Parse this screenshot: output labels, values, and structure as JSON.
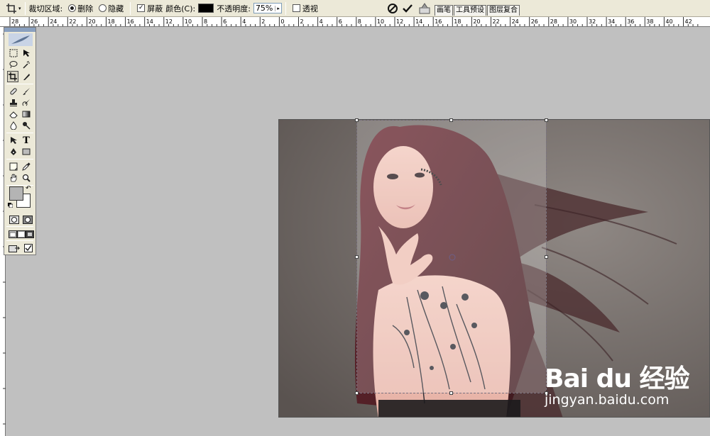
{
  "options_bar": {
    "crop_area_label": "裁切区域:",
    "delete_label": "删除",
    "hide_label": "隐藏",
    "shield_label": "屏蔽",
    "color_label": "颜色(C):",
    "shield_color": "#000000",
    "opacity_label": "不透明度:",
    "opacity_value": "75%",
    "perspective_label": "透视",
    "selected_mode": "删除",
    "shield_checked": true,
    "perspective_checked": false
  },
  "palette_tabs": [
    "画笔",
    "工具预设",
    "图层复合"
  ],
  "ruler_top_labels": [
    "28",
    "26",
    "24",
    "22",
    "20",
    "18",
    "16",
    "14",
    "12",
    "10",
    "8",
    "6",
    "4",
    "2",
    "0",
    "2",
    "4",
    "6",
    "8",
    "10",
    "12",
    "14",
    "16",
    "18",
    "20",
    "22",
    "24",
    "26",
    "28",
    "30",
    "32",
    "34",
    "36",
    "38",
    "40",
    "42"
  ],
  "toolbox": {
    "active_tool": "crop-tool",
    "foreground_color": "#b4b4b4",
    "background_color": "#ffffff"
  },
  "watermark": {
    "brand": "Bai du 经验",
    "url": "jingyan.baidu.com"
  }
}
